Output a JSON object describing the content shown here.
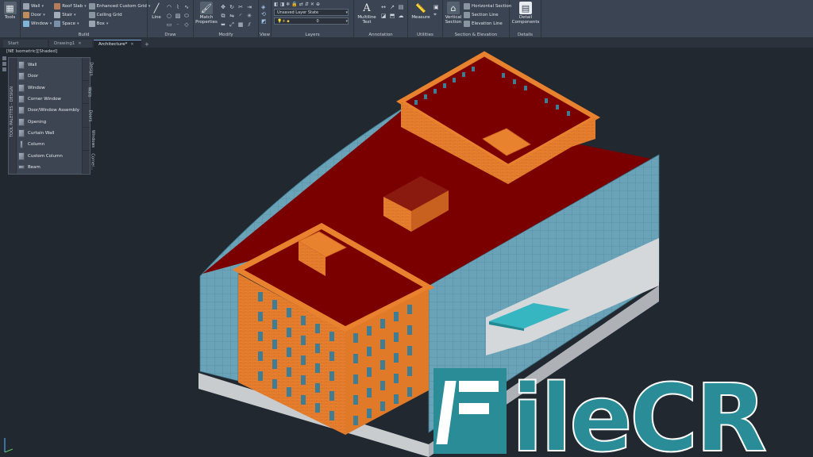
{
  "ribbon": {
    "tools": {
      "label": "Tools"
    },
    "build": {
      "label": "Build",
      "col1": [
        "Wall",
        "Door",
        "Window"
      ],
      "col2": [
        "Roof Slab",
        "Stair",
        "Space"
      ],
      "col3": [
        "Enhanced Custom Grid",
        "Ceiling Grid",
        "Box"
      ]
    },
    "draw": {
      "label": "Draw",
      "line": "Line"
    },
    "modify": {
      "label": "Modify",
      "match": "Match Properties"
    },
    "view": {
      "label": "View"
    },
    "layers": {
      "label": "Layers",
      "current_layer": "Unsaved Layer State",
      "layer_value": "0"
    },
    "annotation": {
      "label": "Annotation",
      "text": "Multiline Text"
    },
    "utilities": {
      "label": "Utilities",
      "measure": "Measure"
    },
    "section": {
      "label": "Section & Elevation",
      "vertical": "Vertical Section",
      "items": [
        "Horizontal Section",
        "Section Line",
        "Elevation Line"
      ]
    },
    "details": {
      "label": "Details",
      "detail": "Detail Components"
    }
  },
  "tabs": [
    {
      "label": "Start"
    },
    {
      "label": "Drawing1"
    },
    {
      "label": "Architecture*"
    }
  ],
  "viewport_label": "[NE Isometric][Shaded]",
  "palette": {
    "strip_text": "TOOL PALETTES - DESIGN",
    "items": [
      "Wall",
      "Door",
      "Window",
      "Corner Window",
      "Door/Window Assembly",
      "Opening",
      "Curtain Wall",
      "Column",
      "Custom Column",
      "Beam"
    ],
    "tabs": [
      "Design",
      "Walls",
      "Doors",
      "Windows",
      "Corner..."
    ]
  },
  "watermark": {
    "text": "FileCR"
  },
  "colors": {
    "roof": "#7a0000",
    "brick": "#e9822f",
    "glass": "#6aa3b8",
    "base": "#c9cccf",
    "background": "#212830",
    "ribbon": "#3b4453"
  }
}
